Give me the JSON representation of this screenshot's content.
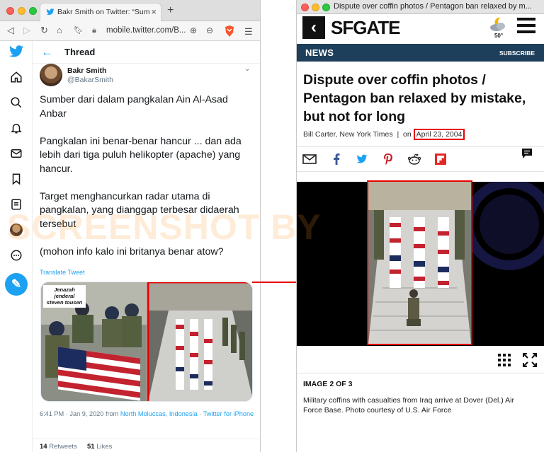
{
  "left_window": {
    "tab": {
      "title": "Bakr Smith on Twitter: “Sumber d",
      "new_tab": "+"
    },
    "address": {
      "url": "mobile.twitter.com/B..."
    },
    "thread": {
      "back": "←",
      "title": "Thread",
      "author_name": "Bakr Smith",
      "author_handle": "@BakarSmith",
      "paragraphs": [
        "Sumber dari dalam pangkalan Ain Al-Asad Anbar",
        "Pangkalan ini benar-benar hancur ... dan ada lebih dari tiga puluh helikopter (apache) yang hancur.",
        "Target menghancurkan radar utama di pangkalan, yang dianggap terbesar didaerah tersebut",
        "(mohon info kalo ini britanya benar atow?"
      ],
      "translate": "Translate Tweet",
      "media_label": "Jenazah jenderal steven tousen",
      "meta_time": "6:41 PM · Jan 9, 2020 from ",
      "meta_place": "North Moluccas, Indonesia",
      "meta_sep": " · ",
      "meta_client": "Twitter for iPhone",
      "retweets_count": "14",
      "retweets_label": "Retweets",
      "likes_count": "51",
      "likes_label": "Likes"
    }
  },
  "right_window": {
    "window_title": "Dispute over coffin photos / Pentagon ban relaxed by m...",
    "logo": "SFGATE",
    "weather_temp": "50°",
    "section": "NEWS",
    "subscribe": "SUBSCRIBE",
    "headline": "Dispute over coffin photos / Pentagon ban relaxed by mistake, but not for long",
    "byline_author": "Bill Carter, New York Times",
    "byline_sep": "  |  on ",
    "byline_date": "April 23, 2004",
    "image_count": "IMAGE 2 OF 3",
    "caption": "Military coffins with casualties from Iraq arrive at Dover (Del.) Air Force Base. Photo courtesy of U.S. Air Force"
  },
  "watermark": "SCREENSHOT BY",
  "colors": {
    "twitter_blue": "#1da1f2",
    "highlight_red": "#e60000",
    "sfgate_navy": "#1e3f5c"
  }
}
